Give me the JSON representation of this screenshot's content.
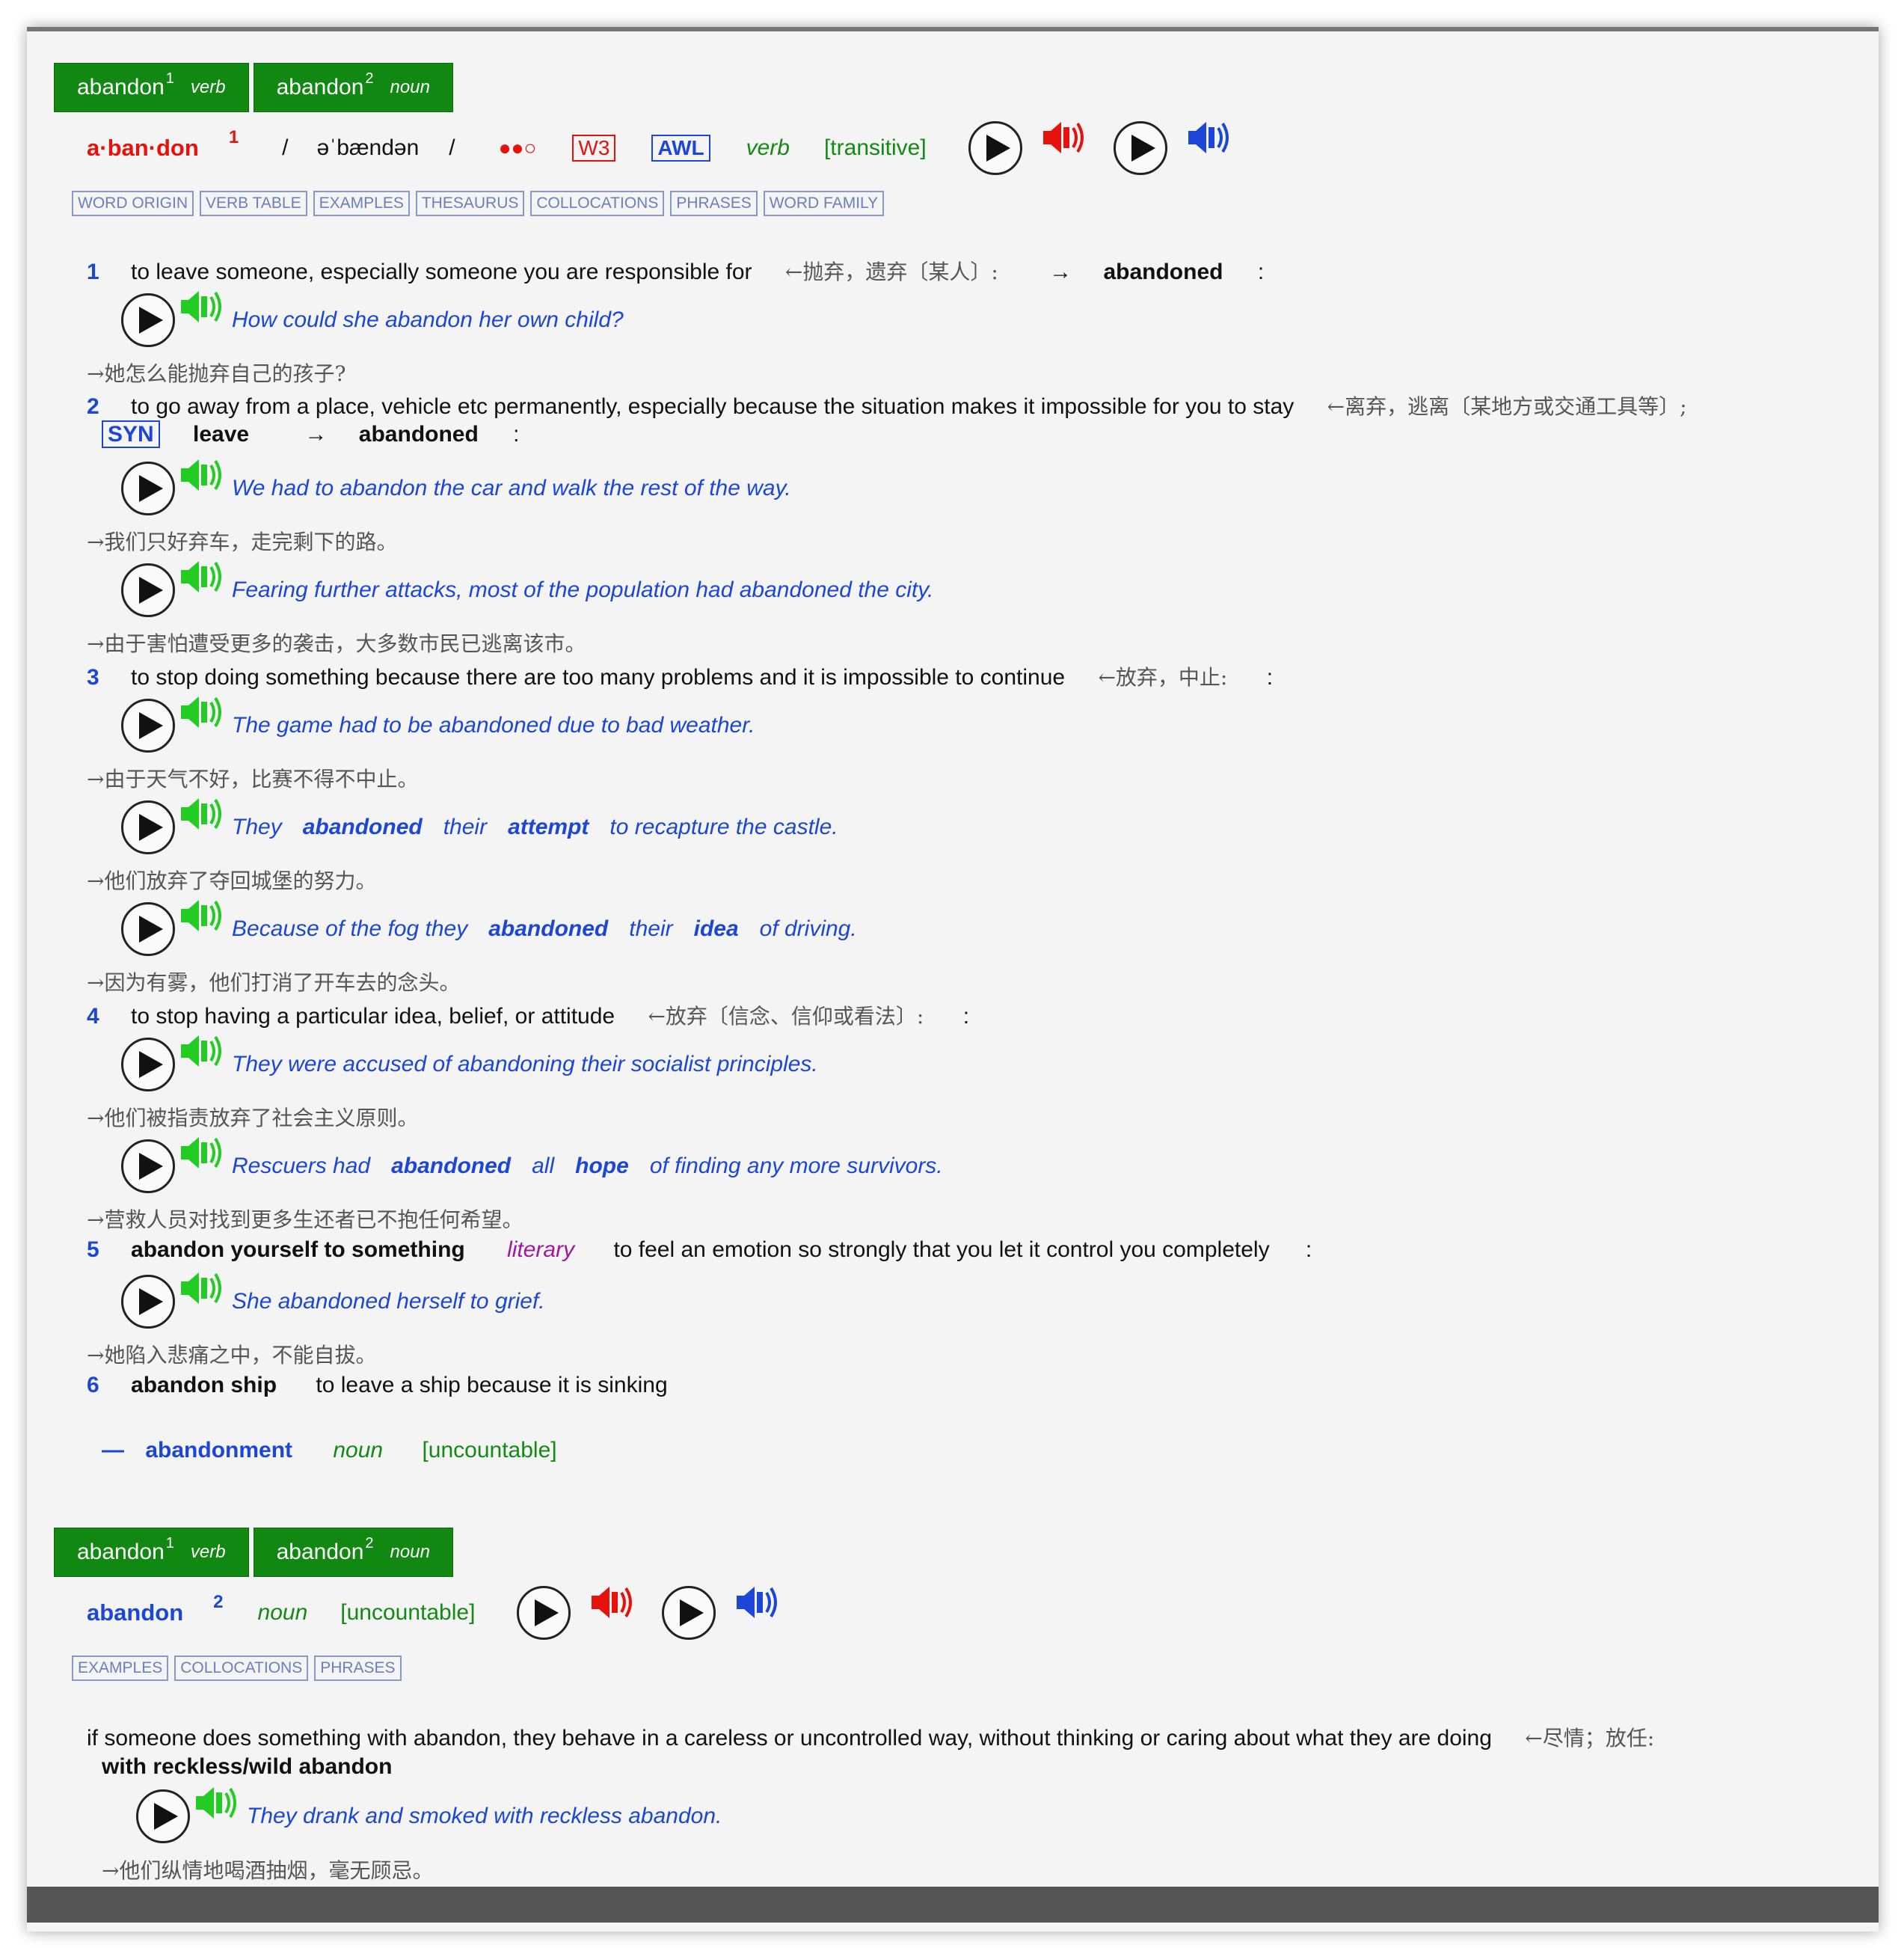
{
  "entry_tabs": [
    {
      "word": "abandon",
      "sup": "1",
      "pos": "verb"
    },
    {
      "word": "abandon",
      "sup": "2",
      "pos": "noun"
    }
  ],
  "entry1": {
    "headword": "a·ban·don",
    "homnum": "1",
    "pron_open": "/",
    "pron": "əˈbændən",
    "pron_close": "/",
    "freq_dots": "●●○",
    "w3": "W3",
    "awl": "AWL",
    "pos": "verb",
    "gram": "[transitive]",
    "tabs": [
      "WORD ORIGIN",
      "VERB TABLE",
      "EXAMPLES",
      "THESAURUS",
      "COLLOCATIONS",
      "PHRASES",
      "WORD FAMILY"
    ],
    "senses": {
      "s1": {
        "num": "1",
        "def": "to leave someone, especially someone you are responsible for",
        "cn": "←抛弃，遗弃〔某人〕:",
        "arrow": "→",
        "deriv": "abandoned",
        "colon": ":"
      },
      "s2": {
        "num": "2",
        "def": "to go away from a place, vehicle etc permanently, especially because the situation makes it impossible for you to stay",
        "cn": "←离弃，逃离〔某地方或交通工具等〕;",
        "syn": "SYN",
        "syn_word": "leave",
        "arrow": "→",
        "deriv": "abandoned",
        "colon": ":"
      },
      "s3": {
        "num": "3",
        "def": "to stop doing something because there are too many problems and it is impossible to continue",
        "cn": "←放弃，中止:",
        "colon": ":"
      },
      "s4": {
        "num": "4",
        "def": "to stop having a particular idea, belief, or attitude",
        "cn": "←放弃〔信念、信仰或看法〕:",
        "colon": ":"
      },
      "s5": {
        "num": "5",
        "phrase": "abandon yourself to something",
        "register": "literary",
        "def": "to feel an emotion so strongly that you let it control you completely",
        "colon": ":"
      },
      "s6": {
        "num": "6",
        "phrase": "abandon ship",
        "def": "to leave a ship because it is sinking"
      }
    },
    "examples": {
      "e1": {
        "text": "How could she abandon her own child?",
        "cn": "→她怎么能抛弃自己的孩子?"
      },
      "e2": {
        "text": "We had to abandon the car and walk the rest of the way.",
        "cn": "→我们只好弃车，走完剩下的路。"
      },
      "e3": {
        "text": "Fearing further attacks, most of the population had abandoned the city.",
        "cn": "→由于害怕遭受更多的袭击，大多数市民已逃离该市。"
      },
      "e4": {
        "text": "The game had to be abandoned due to bad weather.",
        "cn": "→由于天气不好，比赛不得不中止。"
      },
      "e5": {
        "p1": "They",
        "b1": "abandoned",
        "p2": "their",
        "b2": "attempt",
        "p3": "to recapture the castle.",
        "cn": "→他们放弃了夺回城堡的努力。"
      },
      "e6": {
        "p1": "Because of the fog they",
        "b1": "abandoned",
        "p2": "their",
        "b2": "idea",
        "p3": "of driving.",
        "cn": "→因为有雾，他们打消了开车去的念头。"
      },
      "e7": {
        "text": "They were accused of abandoning their socialist principles.",
        "cn": "→他们被指责放弃了社会主义原则。"
      },
      "e8": {
        "p1": "Rescuers had",
        "b1": "abandoned",
        "p2": "all",
        "b2": "hope",
        "p3": "of finding any more survivors.",
        "cn": "→营救人员对找到更多生还者已不抱任何希望。"
      },
      "e9": {
        "text": "She abandoned herself to grief.",
        "cn": "→她陷入悲痛之中，不能自拔。"
      }
    },
    "derived": {
      "dash": "—",
      "word": "abandonment",
      "pos": "noun",
      "gram": "[uncountable]"
    }
  },
  "entry2": {
    "headword": "abandon",
    "homnum": "2",
    "pos": "noun",
    "gram": "[uncountable]",
    "tabs": [
      "EXAMPLES",
      "COLLOCATIONS",
      "PHRASES"
    ],
    "def": "if someone does something with abandon, they behave in a careless or uncontrolled way, without thinking or caring about what they are doing",
    "cn": "←尽情；放任:",
    "colloc": "with reckless/wild abandon",
    "example": {
      "text": "They drank and smoked with reckless abandon.",
      "cn": "→他们纵情地喝酒抽烟，毫无顾忌。"
    }
  },
  "colors": {
    "green_tab": "#118811",
    "red": "#e8120c",
    "blue": "#1b46d8",
    "speaker_green": "#22cc22",
    "label_green": "#138a13"
  },
  "icons": [
    "play-icon",
    "speaker-red-icon",
    "speaker-blue-icon",
    "speaker-green-icon"
  ]
}
